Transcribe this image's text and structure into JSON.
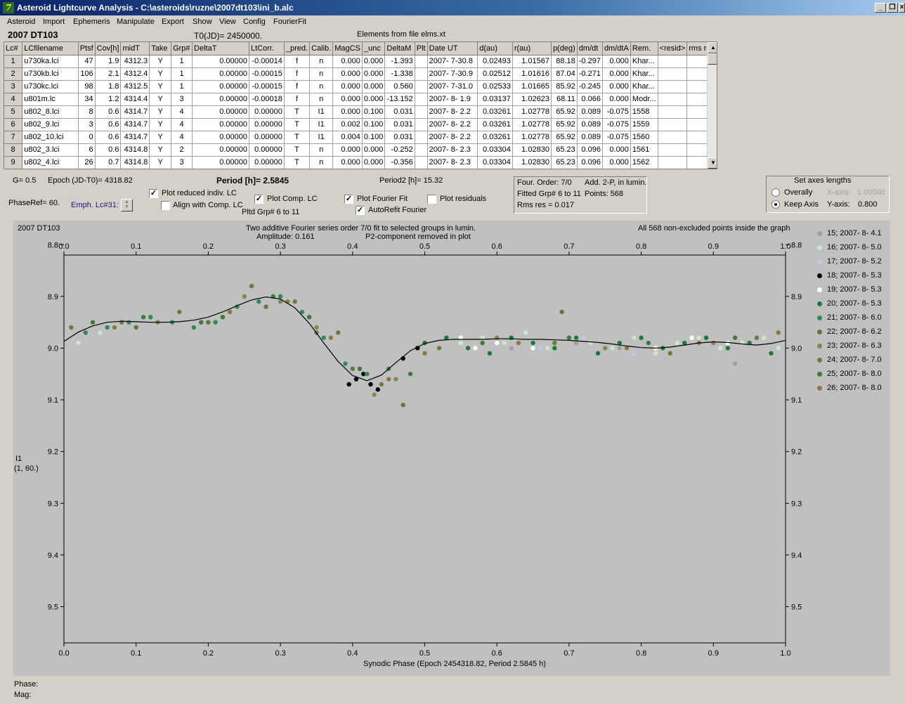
{
  "window": {
    "title": "Asteroid Lightcurve Analysis - C:\\asteroids\\ruzne\\2007dt103\\ini_b.alc",
    "minimize": "_",
    "restore": "❐",
    "close": "×"
  },
  "menu": [
    "Asteroid",
    "Import",
    "Ephemeris",
    "Manipulate",
    "Export",
    "Show",
    "View",
    "Config",
    "FourierFit"
  ],
  "header": {
    "object_name": "2007 DT103",
    "t0": "T0(JD)= 2450000.",
    "elements": "Elements from file elms.xt"
  },
  "table": {
    "columns": [
      "Lc#",
      "LCfilename",
      "Ptsf",
      "Cov[h]",
      "midT",
      "Take",
      "Grp#",
      "DeltaT",
      "LtCorr.",
      "_pred.",
      "Calib.",
      "MagCS",
      "_unc",
      "DeltaM",
      "Plt",
      "Date UT",
      "d(au)",
      "r(au)",
      "p(deg)",
      "dm/dt",
      "dm/dtA",
      "Rem.",
      "<resid>",
      "rms res"
    ],
    "rows": [
      [
        "1",
        "u730ka.lci",
        "47",
        "1.9",
        "4312.3",
        "Y",
        "1",
        "0.00000",
        "-0.00014",
        "f",
        "n",
        "0.000",
        "0.000",
        "-1.393",
        "",
        "2007- 7-30.8",
        "0.02493",
        "1.01567",
        "88.18",
        "-0.297",
        "0.000",
        "Khar...",
        "",
        ""
      ],
      [
        "2",
        "u730kb.lci",
        "106",
        "2.1",
        "4312.4",
        "Y",
        "1",
        "0.00000",
        "-0.00015",
        "f",
        "n",
        "0.000",
        "0.000",
        "-1.338",
        "",
        "2007- 7-30.9",
        "0.02512",
        "1.01616",
        "87.04",
        "-0.271",
        "0.000",
        "Khar...",
        "",
        ""
      ],
      [
        "3",
        "u730kc.lci",
        "98",
        "1.8",
        "4312.5",
        "Y",
        "1",
        "0.00000",
        "-0.00015",
        "f",
        "n",
        "0.000",
        "0.000",
        "0.560",
        "",
        "2007- 7-31.0",
        "0.02533",
        "1.01665",
        "85.92",
        "-0.245",
        "0.000",
        "Khar...",
        "",
        ""
      ],
      [
        "4",
        "u801m.lc",
        "34",
        "1.2",
        "4314.4",
        "Y",
        "3",
        "0.00000",
        "-0.00018",
        "f",
        "n",
        "0.000",
        "0.000",
        "-13.152",
        "",
        "2007- 8- 1.9",
        "0.03137",
        "1.02623",
        "68.11",
        "0.066",
        "0.000",
        "Modr...",
        "",
        ""
      ],
      [
        "5",
        "u802_8.lci",
        "8",
        "0.6",
        "4314.7",
        "Y",
        "4",
        "0.00000",
        "0.00000",
        "T",
        "I1",
        "0.000",
        "0.100",
        "0.031",
        "",
        "2007- 8- 2.2",
        "0.03261",
        "1.02778",
        "65.92",
        "0.089",
        "-0.075",
        "1558",
        "",
        ""
      ],
      [
        "6",
        "u802_9.lci",
        "3",
        "0.6",
        "4314.7",
        "Y",
        "4",
        "0.00000",
        "0.00000",
        "T",
        "I1",
        "0.002",
        "0.100",
        "0.031",
        "",
        "2007- 8- 2.2",
        "0.03261",
        "1.02778",
        "65.92",
        "0.089",
        "-0.075",
        "1559",
        "",
        ""
      ],
      [
        "7",
        "u802_10.lci",
        "0",
        "0.6",
        "4314.7",
        "Y",
        "4",
        "0.00000",
        "0.00000",
        "T",
        "I1",
        "0.004",
        "0.100",
        "0.031",
        "",
        "2007- 8- 2.2",
        "0.03261",
        "1.02778",
        "65.92",
        "0.089",
        "-0.075",
        "1560",
        "",
        ""
      ],
      [
        "8",
        "u802_3.lci",
        "6",
        "0.6",
        "4314.8",
        "Y",
        "2",
        "0.00000",
        "0.00000",
        "T",
        "n",
        "0.000",
        "0.000",
        "-0.252",
        "",
        "2007- 8- 2.3",
        "0.03304",
        "1.02830",
        "65.23",
        "0.096",
        "0.000",
        "1561",
        "",
        ""
      ],
      [
        "9",
        "u802_4.lci",
        "26",
        "0.7",
        "4314.8",
        "Y",
        "3",
        "0.00000",
        "0.00000",
        "T",
        "n",
        "0.000",
        "0.000",
        "-0.356",
        "",
        "2007- 8- 2.3",
        "0.03304",
        "1.02830",
        "65.23",
        "0.096",
        "0.000",
        "1562",
        "",
        ""
      ]
    ]
  },
  "controls": {
    "g": "G= 0.5",
    "epoch": "Epoch (JD-T0)= 4318.82",
    "period": "Period [h]= 2.5845",
    "period2": "Period2 [h]= 15.32",
    "phase_ref": "PhaseRef= 60.",
    "emph_lc": "Emph. Lc#31:",
    "plot_reduced": {
      "label": "Plot reduced indiv. LC",
      "checked": true
    },
    "align_comp": {
      "label": "Align with Comp. LC",
      "checked": false
    },
    "plot_comp": {
      "label": "Plot Comp. LC",
      "checked": true
    },
    "pltd_grp": "Pltd Grp#  6   to   11",
    "plot_fourier": {
      "label": "Plot Fourier Fit",
      "checked": true
    },
    "autorefit": {
      "label": "AutoRefit Fourier",
      "checked": true
    },
    "plot_resid": {
      "label": "Plot residuals",
      "checked": false
    },
    "check_mark": "✓"
  },
  "fit_info": {
    "order": "Four. Order:  7/0",
    "add": "Add. 2-P, in lumin.",
    "fitted": "Fitted Grp# 6 to 11",
    "points": "Points: 568",
    "rms": "Rms res     = 0.017"
  },
  "axes_box": {
    "title": "Set axes lengths",
    "overally": "Overally",
    "keep_axis": "Keep Axis",
    "x_axis_label": "X-axis:",
    "x_axis_value": "1.00000",
    "y_axis_label": "Y-axis:",
    "y_axis_value": "0.800",
    "selected": "Keep Axis"
  },
  "plot": {
    "object": "2007 DT103",
    "caption1": "Two additive Fourier series order 7/0 fit to selected groups in lumin.",
    "caption2": "Amplitude: 0.161",
    "caption3": "P2-component removed in plot",
    "caption_right": "All 568 non-excluded points inside the graph",
    "ylabel1": "I1",
    "ylabel2": "(1, 60.)",
    "xlabel": "Synodic Phase (Epoch 2454318.82, Period 2.5845 h)"
  },
  "chart_data": {
    "type": "scatter",
    "x_range": [
      0.0,
      1.0
    ],
    "y_range": [
      9.57,
      8.82
    ],
    "y_inverted": true,
    "x_ticks": [
      "0.0",
      "0.1",
      "0.2",
      "0.3",
      "0.4",
      "0.5",
      "0.6",
      "0.7",
      "0.8",
      "0.9",
      "1.0"
    ],
    "y_ticks": [
      "8.8",
      "8.9",
      "9.0",
      "9.1",
      "9.2",
      "9.3",
      "9.4",
      "9.5"
    ],
    "grid": false,
    "legend_position": "right",
    "fourier_fit": {
      "x": [
        0.0,
        0.02,
        0.04,
        0.06,
        0.08,
        0.1,
        0.12,
        0.14,
        0.16,
        0.18,
        0.2,
        0.22,
        0.24,
        0.26,
        0.28,
        0.3,
        0.32,
        0.34,
        0.36,
        0.38,
        0.4,
        0.42,
        0.44,
        0.46,
        0.48,
        0.5,
        0.52,
        0.54,
        0.56,
        0.58,
        0.6,
        0.62,
        0.64,
        0.66,
        0.68,
        0.7,
        0.72,
        0.74,
        0.76,
        0.78,
        0.8,
        0.82,
        0.84,
        0.86,
        0.88,
        0.9,
        0.92,
        0.94,
        0.96,
        0.98,
        1.0
      ],
      "y": [
        8.987,
        8.969,
        8.957,
        8.95,
        8.948,
        8.949,
        8.95,
        8.95,
        8.949,
        8.946,
        8.94,
        8.93,
        8.918,
        8.907,
        8.901,
        8.905,
        8.922,
        8.952,
        8.99,
        9.026,
        9.053,
        9.063,
        9.052,
        9.028,
        9.005,
        8.991,
        8.985,
        8.983,
        8.983,
        8.983,
        8.982,
        8.982,
        8.983,
        8.983,
        8.984,
        8.985,
        8.987,
        8.989,
        8.992,
        8.996,
        8.999,
        9.0,
        8.998,
        8.994,
        8.99,
        8.988,
        8.989,
        8.992,
        8.994,
        8.991,
        8.985
      ]
    },
    "series": [
      {
        "name": "15; 2007- 8- 4.1",
        "color": "#a0a0a0",
        "x": [
          0.62,
          0.71,
          0.74,
          0.77,
          0.93
        ],
        "y": [
          9.0,
          8.99,
          9.01,
          9.0,
          9.03
        ]
      },
      {
        "name": "16; 2007- 8- 5.0",
        "color": "#c8e8c8",
        "x": [
          0.02,
          0.05,
          0.52,
          0.55,
          0.58,
          0.61,
          0.64,
          0.67,
          0.7,
          0.73,
          0.76,
          0.79,
          0.82,
          0.85,
          0.88,
          0.91,
          0.94,
          0.97,
          0.99
        ],
        "y": [
          8.99,
          8.97,
          9.0,
          8.99,
          8.98,
          8.99,
          8.97,
          9.0,
          8.98,
          8.99,
          9.0,
          8.98,
          9.01,
          8.99,
          8.98,
          9.0,
          8.99,
          8.98,
          9.0
        ]
      },
      {
        "name": "17; 2007- 8- 5.2",
        "color": "#b8cce8",
        "x": [
          0.6,
          0.66,
          0.72,
          0.79,
          0.86
        ],
        "y": [
          8.99,
          9.0,
          8.98,
          9.01,
          8.99
        ]
      },
      {
        "name": "18; 2007- 8- 5.3",
        "color": "#000000",
        "x": [
          0.395,
          0.405,
          0.415,
          0.425,
          0.435,
          0.47,
          0.49
        ],
        "y": [
          9.07,
          9.06,
          9.05,
          9.07,
          9.08,
          9.02,
          9.0
        ]
      },
      {
        "name": "19; 2007- 8- 5.3",
        "color": "#ffffff",
        "x": [
          0.55,
          0.57,
          0.6,
          0.65,
          0.71,
          0.77,
          0.82,
          0.87,
          0.92
        ],
        "y": [
          8.98,
          9.0,
          8.99,
          9.0,
          8.98,
          8.99,
          9.0,
          8.98,
          8.99
        ]
      },
      {
        "name": "20; 2007- 8- 5.3",
        "color": "#1a7a3a",
        "x": [
          0.5,
          0.53,
          0.56,
          0.59,
          0.62,
          0.65,
          0.68,
          0.71,
          0.74,
          0.77,
          0.8,
          0.83,
          0.86,
          0.89,
          0.92,
          0.95,
          0.98
        ],
        "y": [
          8.99,
          8.98,
          9.0,
          9.01,
          8.98,
          8.99,
          9.0,
          8.98,
          9.01,
          8.99,
          8.98,
          9.0,
          8.99,
          8.98,
          9.0,
          8.99,
          9.01
        ]
      },
      {
        "name": "21; 2007- 8- 6.0",
        "color": "#2e8b57",
        "x": [
          0.03,
          0.06,
          0.09,
          0.12,
          0.15,
          0.18,
          0.21,
          0.24,
          0.27,
          0.3,
          0.33,
          0.36,
          0.39,
          0.42,
          0.45
        ],
        "y": [
          8.97,
          8.96,
          8.95,
          8.94,
          8.95,
          8.96,
          8.95,
          8.92,
          8.91,
          8.9,
          8.93,
          8.98,
          9.03,
          9.05,
          9.04
        ]
      },
      {
        "name": "22; 2007- 8- 6.2",
        "color": "#607840",
        "x": [
          0.1,
          0.2,
          0.28,
          0.35,
          0.4,
          0.47,
          0.69
        ],
        "y": [
          8.96,
          8.95,
          8.92,
          8.97,
          9.04,
          9.11,
          8.93
        ]
      },
      {
        "name": "23; 2007- 8- 6.3",
        "color": "#7a8a50",
        "x": [
          0.25,
          0.3,
          0.35,
          0.43,
          0.46,
          0.6,
          0.75,
          0.9
        ],
        "y": [
          8.9,
          8.91,
          8.96,
          9.09,
          9.06,
          8.98,
          9.0,
          8.99
        ]
      },
      {
        "name": "24; 2007- 8- 7.0",
        "color": "#6a7a3a",
        "x": [
          0.01,
          0.08,
          0.16,
          0.26,
          0.32,
          0.38,
          0.44,
          0.52,
          0.68,
          0.84,
          0.96
        ],
        "y": [
          8.96,
          8.95,
          8.93,
          8.88,
          8.91,
          8.97,
          9.07,
          9.0,
          8.99,
          9.01,
          8.98
        ]
      },
      {
        "name": "25; 2007- 8- 8.0",
        "color": "#3a7a3a",
        "x": [
          0.04,
          0.11,
          0.19,
          0.22,
          0.29,
          0.34,
          0.41,
          0.48,
          0.58,
          0.7,
          0.81,
          0.93
        ],
        "y": [
          8.95,
          8.94,
          8.95,
          8.94,
          8.9,
          8.94,
          9.04,
          9.05,
          8.99,
          8.98,
          8.99,
          8.98
        ]
      },
      {
        "name": "26; 2007- 8- 8.0",
        "color": "#8a7a40",
        "x": [
          0.07,
          0.13,
          0.23,
          0.31,
          0.37,
          0.45,
          0.5,
          0.63,
          0.78,
          0.88,
          0.99
        ],
        "y": [
          8.96,
          8.95,
          8.93,
          8.91,
          8.98,
          9.06,
          9.01,
          8.99,
          9.0,
          8.99,
          8.97
        ]
      }
    ]
  },
  "status": {
    "phase": "Phase:",
    "mag": "Mag:"
  }
}
